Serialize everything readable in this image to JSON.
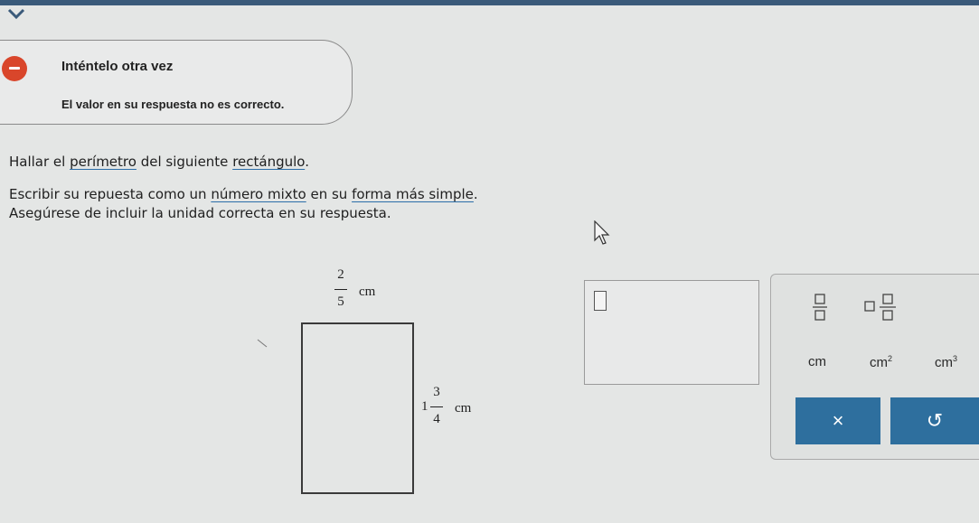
{
  "feedback": {
    "title": "Inténtelo otra vez",
    "message": "El valor en su respuesta no es correcto."
  },
  "question": {
    "line1_pre": "Hallar el ",
    "line1_link1": "perímetro",
    "line1_mid": " del siguiente ",
    "line1_link2": "rectángulo",
    "line1_post": ".",
    "line2_pre": "Escribir su repuesta como un ",
    "line2_link1": "número mixto",
    "line2_mid": " en su ",
    "line2_link2": "forma más simple",
    "line2_post": ".",
    "line3": "Asegúrese de incluir la unidad correcta en su respuesta."
  },
  "figure": {
    "width_num": "2",
    "width_den": "5",
    "width_unit": "cm",
    "height_whole": "1",
    "height_num": "3",
    "height_den": "4",
    "height_unit": "cm"
  },
  "keypad": {
    "unit_cm": "cm",
    "unit_cm2_base": "cm",
    "unit_cm2_exp": "2",
    "unit_cm3_base": "cm",
    "unit_cm3_exp": "3",
    "clear_label": "×",
    "undo_label": "↺"
  }
}
